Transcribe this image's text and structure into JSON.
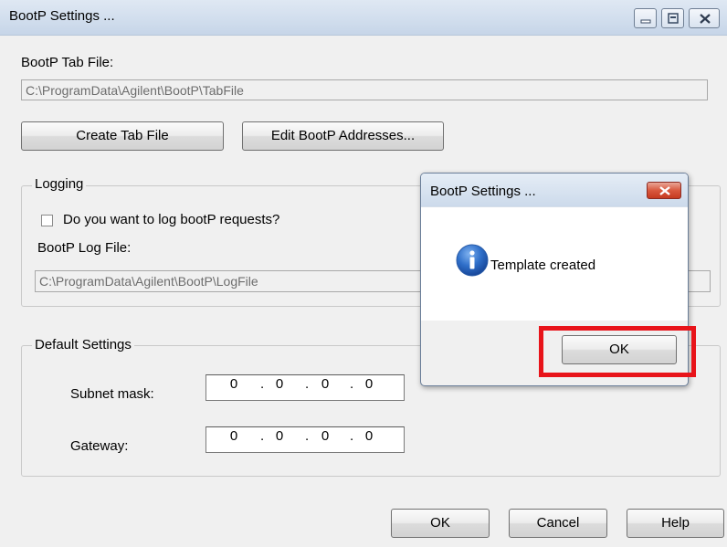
{
  "window": {
    "title": "BootP Settings ...",
    "tab_file_label": "BootP Tab File:",
    "tab_file_path": "C:\\ProgramData\\Agilent\\BootP\\TabFile",
    "create_tab_file": "Create Tab File",
    "edit_addresses": "Edit BootP Addresses...",
    "logging": {
      "title": "Logging",
      "log_checkbox_label": "Do you want to log bootP requests?",
      "log_checkbox_checked": false,
      "log_file_label": "BootP Log File:",
      "log_file_path": "C:\\ProgramData\\Agilent\\BootP\\LogFile"
    },
    "defaults": {
      "title": "Default Settings",
      "subnet_label": "Subnet mask:",
      "subnet": [
        "0",
        "0",
        "0",
        "0"
      ],
      "gateway_label": "Gateway:",
      "gateway": [
        "0",
        "0",
        "0",
        "0"
      ]
    },
    "ok": "OK",
    "cancel": "Cancel",
    "help": "Help"
  },
  "message_box": {
    "title": "BootP Settings ...",
    "message": "Template created",
    "icon": "info-icon",
    "ok": "OK"
  },
  "colors": {
    "highlight": "#e8141a",
    "info_icon": "#1f5fb8"
  }
}
